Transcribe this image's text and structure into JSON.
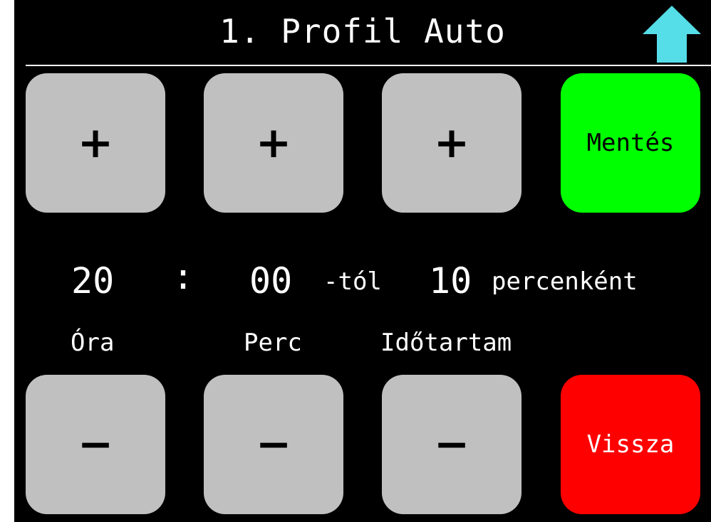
{
  "header": {
    "title": "1. Profil Auto",
    "home_icon": "up-arrow-icon",
    "home_color": "#55dde8"
  },
  "controls": {
    "increment_symbol": "+",
    "decrement_symbol": "−",
    "save_label": "Mentés",
    "save_color": "#00ff00",
    "back_label": "Vissza",
    "back_color": "#ff0000",
    "stepper_color": "#c0c0c0"
  },
  "schedule": {
    "hour": "20",
    "separator": ":",
    "minute": "00",
    "from_suffix": "-tól",
    "interval": "10",
    "interval_suffix": "percenként"
  },
  "labels": {
    "hour": "Óra",
    "minute": "Perc",
    "duration": "Időtartam"
  }
}
